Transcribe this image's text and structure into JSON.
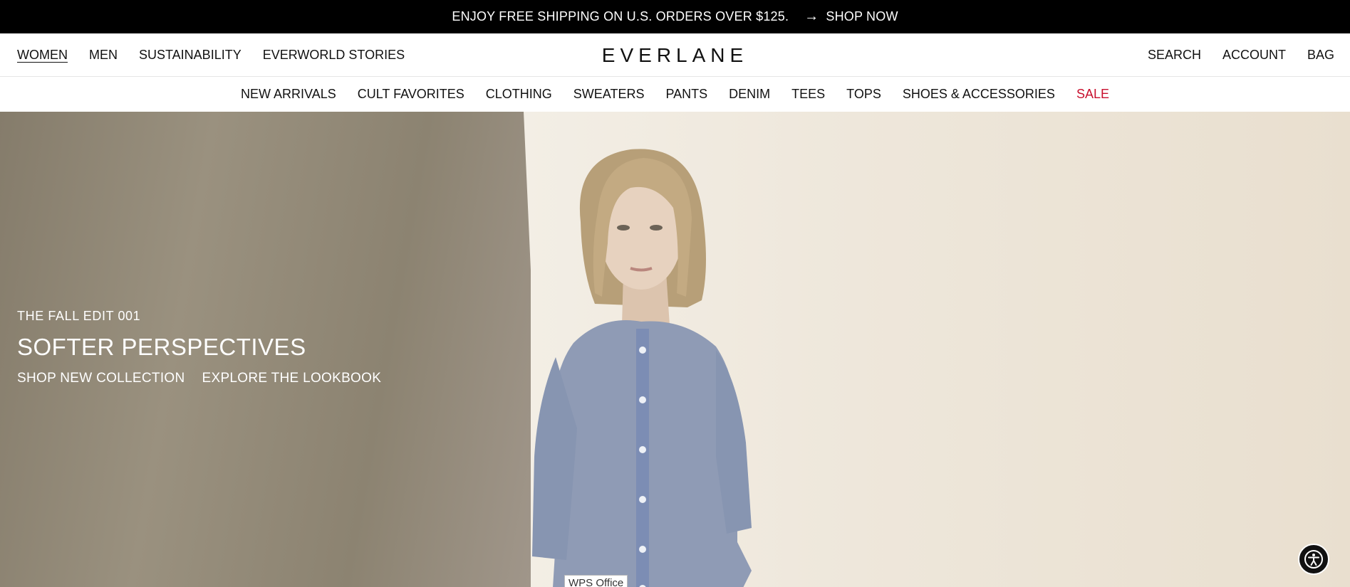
{
  "promo": {
    "text": "ENJOY FREE SHIPPING ON U.S. ORDERS OVER $125.",
    "arrow": "→",
    "link_label": "SHOP NOW"
  },
  "header": {
    "left_links": [
      "WOMEN",
      "MEN",
      "SUSTAINABILITY",
      "EVERWORLD STORIES"
    ],
    "logo": "EVERLANE",
    "right_links": [
      "SEARCH",
      "ACCOUNT",
      "BAG"
    ]
  },
  "categories": [
    "NEW ARRIVALS",
    "CULT FAVORITES",
    "CLOTHING",
    "SWEATERS",
    "PANTS",
    "DENIM",
    "TEES",
    "TOPS",
    "SHOES & ACCESSORIES",
    "SALE"
  ],
  "hero": {
    "eyebrow": "THE FALL EDIT 001",
    "headline": "SOFTER PERSPECTIVES",
    "cta_primary": "SHOP NEW COLLECTION",
    "cta_secondary": "EXPLORE THE LOOKBOOK"
  },
  "tooltip": "WPS Office",
  "colors": {
    "promo_bg": "#000000",
    "sale": "#c8102e",
    "a11y_bg": "#111111"
  },
  "icons": {
    "accessibility": "accessibility-icon"
  }
}
